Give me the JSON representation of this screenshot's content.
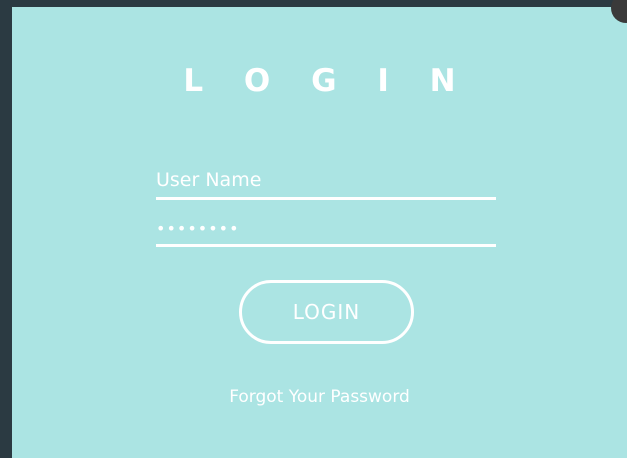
{
  "login_form": {
    "title": "L O G I N",
    "username": {
      "placeholder": "User Name",
      "value": ""
    },
    "password": {
      "placeholder": "",
      "value": "........"
    },
    "submit_label": "LOGIN",
    "forgot_link": "Forgot Your Password"
  },
  "colors": {
    "modal_background": "#abe4e3",
    "page_background": "#2b3a42",
    "foreground": "#ffffff"
  }
}
